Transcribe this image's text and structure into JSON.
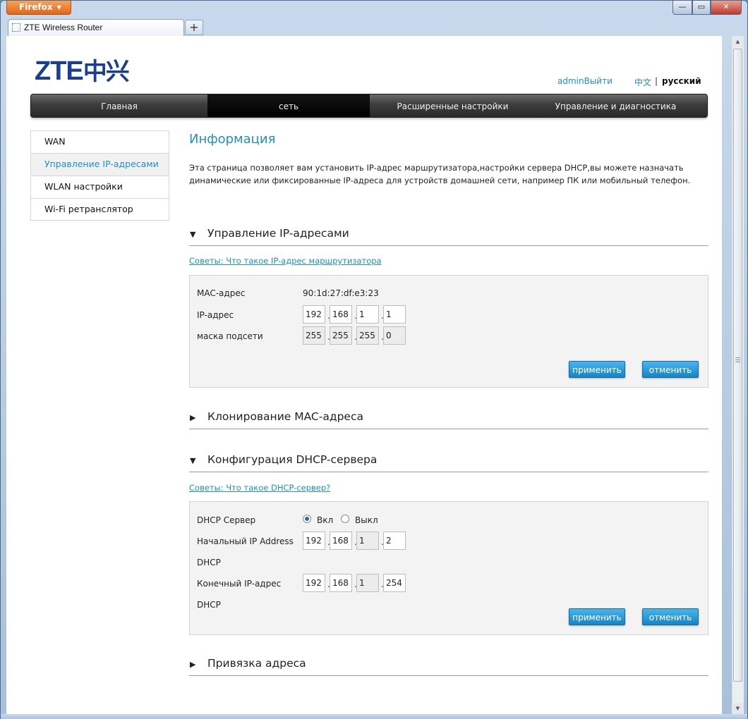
{
  "browser": {
    "menu_button": "Firefox",
    "tab_title": "ZTE Wireless Router",
    "new_tab_symbol": "+",
    "minimize_symbol": "—",
    "maximize_symbol": "▭",
    "close_symbol": "✕"
  },
  "header": {
    "logo_latin": "ZTE",
    "logo_cn": "中兴",
    "admin_link": "adminВыйти",
    "lang_zh": "中文",
    "lang_separator": "|",
    "lang_ru": "русский"
  },
  "nav": {
    "items": [
      {
        "label": "Главная",
        "active": false
      },
      {
        "label": "сеть",
        "active": true
      },
      {
        "label": "Расширенные настройки",
        "active": false
      },
      {
        "label": "Управление и диагностика",
        "active": false
      }
    ]
  },
  "sidebar": {
    "items": [
      {
        "label": "WAN",
        "active": false
      },
      {
        "label": "Управление IP-адресами",
        "active": true
      },
      {
        "label": "WLAN настройки",
        "active": false
      },
      {
        "label": "Wi-Fi ретранслятор",
        "active": false
      }
    ]
  },
  "main": {
    "title": "Информация",
    "description": "Эта страница позволяет вам установить IP-адрес маршрутизатора,настройки сервера DHCP,вы можете назначать динамические или фиксированные IP-адреса для устройств домашней сети, например ПК или мобильный телефон.",
    "ip_section": {
      "heading": "Управление IP-адресами",
      "toggle": "▼",
      "tip": "Советы: Что такое IP-адрес маршрутизатора",
      "mac_label": "MAC-адрес",
      "mac_value": "90:1d:27:df:e3:23",
      "ip_label": "IP-адрес",
      "ip_octets": [
        "192",
        "168",
        "1",
        "1"
      ],
      "mask_label": "маска подсети",
      "mask_octets": [
        "255",
        "255",
        "255",
        "0"
      ],
      "apply": "применить",
      "cancel": "отменить"
    },
    "mac_clone_section": {
      "heading": "Клонирование MAC-адреса",
      "toggle": "▶"
    },
    "dhcp_section": {
      "heading": "Конфигурация DHCP-сервера",
      "toggle": "▼",
      "tip": "Советы: Что такое DHCP-сервер?",
      "server_label": "DHCP Сервер",
      "on_label": "Вкл",
      "off_label": "Выкл",
      "server_enabled": true,
      "start_label": "Начальный IP Address",
      "start_label_2": "DHCP",
      "start_octets": [
        "192",
        "168",
        "1",
        "2"
      ],
      "end_label": "Конечный IP-адрес",
      "end_label_2": "DHCP",
      "end_octets": [
        "192",
        "168",
        "1",
        "254"
      ],
      "apply": "применить",
      "cancel": "отменить"
    },
    "binding_section": {
      "heading": "Привязка адреса",
      "toggle": "▶"
    }
  },
  "icons": {
    "dropdown": "chevron-down-icon",
    "expanded": "triangle-down-icon",
    "collapsed": "triangle-right-icon"
  }
}
